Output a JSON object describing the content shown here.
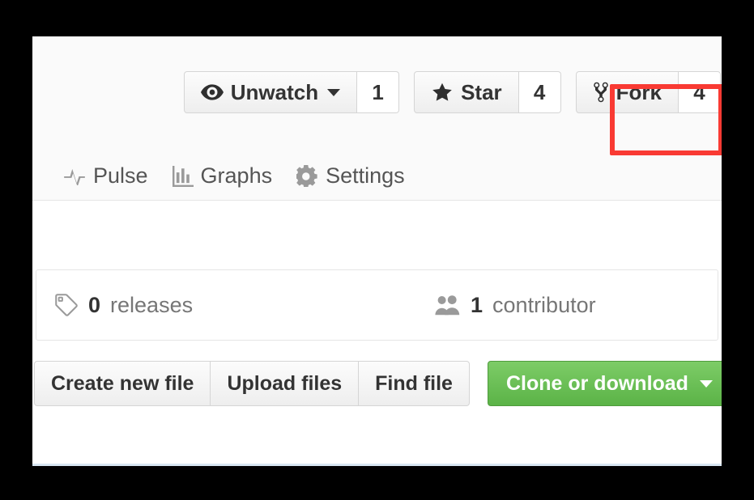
{
  "colors": {
    "highlight": "#f93a33",
    "primary_button": "#5bb347",
    "page_background": "#fafafa",
    "body_background": "#ffffff",
    "border": "#e5e5e5",
    "muted_text": "#767676",
    "bottom_rule": "#d8e6f2"
  },
  "pagehead_actions": {
    "watch": {
      "label": "Unwatch",
      "icon": "eye-icon",
      "count": "1",
      "has_caret": true
    },
    "star": {
      "label": "Star",
      "icon": "star-icon",
      "count": "4",
      "has_caret": false
    },
    "fork": {
      "label": "Fork",
      "icon": "repo-forked-icon",
      "count": "4",
      "has_caret": false,
      "highlighted": true
    }
  },
  "repo_nav": {
    "tabs": [
      {
        "label": "Pulse",
        "icon": "pulse-icon"
      },
      {
        "label": "Graphs",
        "icon": "graph-icon"
      },
      {
        "label": "Settings",
        "icon": "gear-icon"
      }
    ]
  },
  "numbers_summary": {
    "releases": {
      "icon": "tag-icon",
      "count": "0",
      "label": "releases"
    },
    "contributors": {
      "icon": "organization-icon",
      "count": "1",
      "label": "contributor"
    }
  },
  "file_navigation": {
    "buttons": [
      {
        "label": "Create new file"
      },
      {
        "label": "Upload files"
      },
      {
        "label": "Find file"
      }
    ],
    "clone_button": {
      "label": "Clone or download",
      "has_caret": true
    }
  }
}
